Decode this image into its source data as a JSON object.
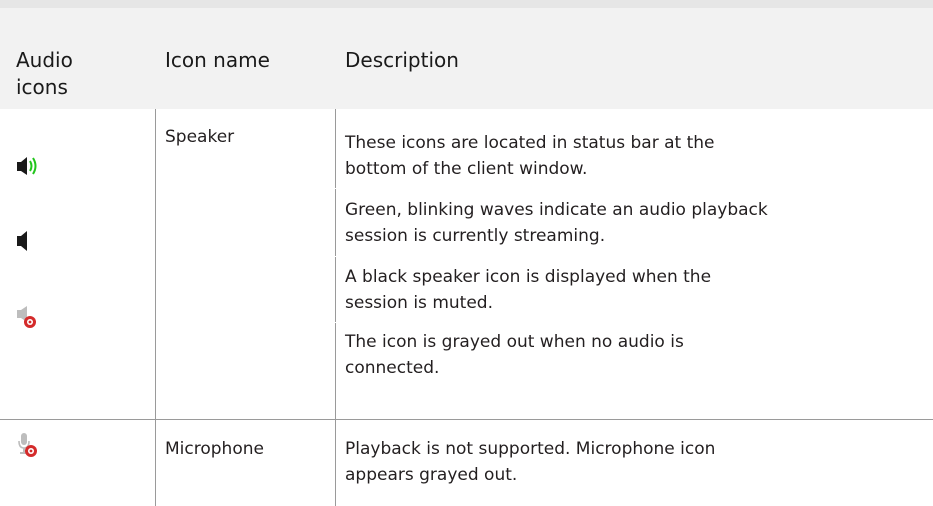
{
  "table": {
    "headers": {
      "col1": "Audio\nicons",
      "col2": "Icon name",
      "col3": "Description"
    },
    "rows": [
      {
        "icons": [
          "speaker-waves-icon",
          "speaker-muted-icon",
          "speaker-disconnected-icon"
        ],
        "name": "Speaker",
        "descriptions": [
          "These icons are located in status bar at the\nbottom of the client window.",
          "Green, blinking waves indicate an audio playback\nsession is currently streaming.",
          "A black speaker icon is displayed when the\nsession is muted.",
          "The icon is grayed out when no audio is\nconnected."
        ]
      },
      {
        "icons": [
          "microphone-disconnected-icon"
        ],
        "name": "Microphone",
        "descriptions": [
          "Playback is not supported. Microphone icon\nappears grayed out."
        ]
      }
    ]
  },
  "colors": {
    "header_bg": "#f2f2f2",
    "wave_green": "#22c51c",
    "disconnect_red": "#d42b2b",
    "grid_line": "#9a9a9a"
  }
}
